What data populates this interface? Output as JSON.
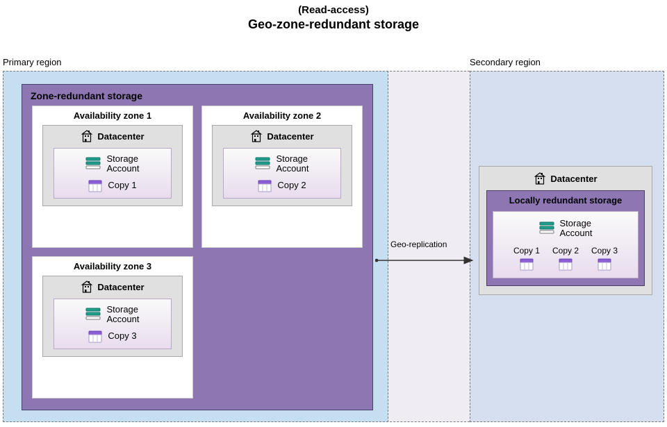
{
  "title": {
    "super": "(Read-access)",
    "main": "Geo-zone-redundant storage"
  },
  "labels": {
    "primary": "Primary region",
    "secondary": "Secondary region",
    "geo_replication": "Geo-replication",
    "zrs": "Zone-redundant storage",
    "lrs": "Locally redundant storage",
    "datacenter": "Datacenter",
    "storage_account": "Storage\nAccount"
  },
  "primary": {
    "zones": [
      {
        "name": "Availability zone 1",
        "copy": "Copy 1"
      },
      {
        "name": "Availability zone 2",
        "copy": "Copy 2"
      },
      {
        "name": "Availability zone 3",
        "copy": "Copy 3"
      }
    ]
  },
  "secondary": {
    "copies": [
      "Copy 1",
      "Copy 2",
      "Copy 3"
    ]
  }
}
